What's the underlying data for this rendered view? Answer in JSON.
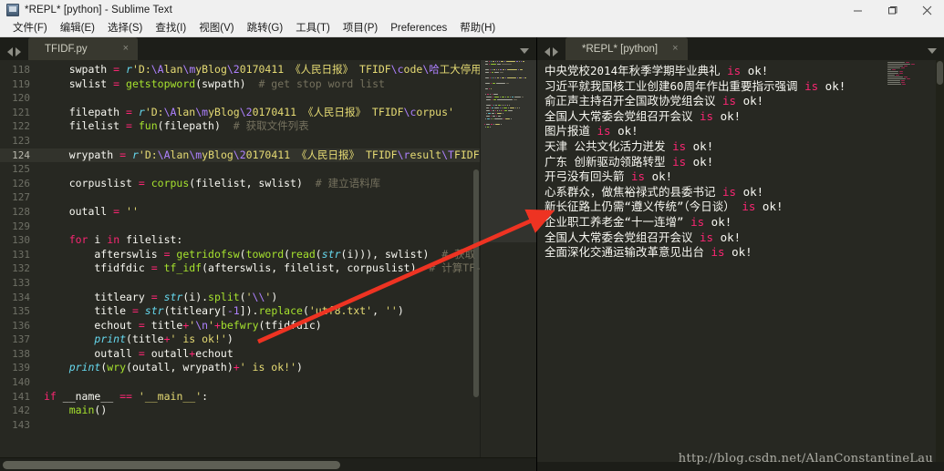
{
  "window": {
    "title": "*REPL* [python] - Sublime Text",
    "app_icon": "sublime-text-icon",
    "controls": {
      "minimize": "minimize-icon",
      "maximize": "maximize-icon",
      "close": "close-icon"
    }
  },
  "menubar": {
    "items": [
      "文件(F)",
      "编辑(E)",
      "选择(S)",
      "查找(I)",
      "视图(V)",
      "跳转(G)",
      "工具(T)",
      "项目(P)",
      "Preferences",
      "帮助(H)"
    ]
  },
  "left_pane": {
    "tab": {
      "label": "TFIDF.py",
      "close": "×"
    },
    "nav_prev": "nav-prev-icon",
    "nav_next": "nav-next-icon",
    "tab_menu": "tab-list-caret-icon",
    "current_line": 124,
    "lines": [
      {
        "n": 118,
        "tokens": [
          {
            "t": "    swpath ",
            "c": "p"
          },
          {
            "t": "= ",
            "c": "k"
          },
          {
            "t": "r",
            "c": "f"
          },
          {
            "t": "'D:",
            "c": "s"
          },
          {
            "t": "\\A",
            "c": "n"
          },
          {
            "t": "lan",
            "c": "s"
          },
          {
            "t": "\\m",
            "c": "n"
          },
          {
            "t": "yBlog",
            "c": "s"
          },
          {
            "t": "\\2",
            "c": "n"
          },
          {
            "t": "0170411 《人民日报》 TFIDF",
            "c": "s"
          },
          {
            "t": "\\c",
            "c": "n"
          },
          {
            "t": "ode",
            "c": "s"
          },
          {
            "t": "\\哈",
            "c": "n"
          },
          {
            "t": "工大停用",
            "c": "s"
          }
        ]
      },
      {
        "n": 119,
        "tokens": [
          {
            "t": "    swlist ",
            "c": "p"
          },
          {
            "t": "= ",
            "c": "k"
          },
          {
            "t": "getstopword",
            "c": "fn"
          },
          {
            "t": "(swpath)  ",
            "c": "p"
          },
          {
            "t": "# get stop word list",
            "c": "c"
          }
        ]
      },
      {
        "n": 120,
        "tokens": []
      },
      {
        "n": 121,
        "tokens": [
          {
            "t": "    filepath ",
            "c": "p"
          },
          {
            "t": "= ",
            "c": "k"
          },
          {
            "t": "r",
            "c": "f"
          },
          {
            "t": "'D:",
            "c": "s"
          },
          {
            "t": "\\A",
            "c": "n"
          },
          {
            "t": "lan",
            "c": "s"
          },
          {
            "t": "\\m",
            "c": "n"
          },
          {
            "t": "yBlog",
            "c": "s"
          },
          {
            "t": "\\2",
            "c": "n"
          },
          {
            "t": "0170411 《人民日报》 TFIDF",
            "c": "s"
          },
          {
            "t": "\\c",
            "c": "n"
          },
          {
            "t": "orpus'",
            "c": "s"
          }
        ]
      },
      {
        "n": 122,
        "tokens": [
          {
            "t": "    filelist ",
            "c": "p"
          },
          {
            "t": "= ",
            "c": "k"
          },
          {
            "t": "fun",
            "c": "fn"
          },
          {
            "t": "(filepath)  ",
            "c": "p"
          },
          {
            "t": "# 获取文件列表",
            "c": "c"
          }
        ]
      },
      {
        "n": 123,
        "tokens": []
      },
      {
        "n": 124,
        "tokens": [
          {
            "t": "    wrypath ",
            "c": "p"
          },
          {
            "t": "= ",
            "c": "k"
          },
          {
            "t": "r",
            "c": "f"
          },
          {
            "t": "'D:",
            "c": "s"
          },
          {
            "t": "\\A",
            "c": "n"
          },
          {
            "t": "lan",
            "c": "s"
          },
          {
            "t": "\\m",
            "c": "n"
          },
          {
            "t": "yBlog",
            "c": "s"
          },
          {
            "t": "\\2",
            "c": "n"
          },
          {
            "t": "0170411 《人民日报》 TFIDF",
            "c": "s"
          },
          {
            "t": "\\r",
            "c": "n"
          },
          {
            "t": "esult",
            "c": "s"
          },
          {
            "t": "\\T",
            "c": "n"
          },
          {
            "t": "FIDF.",
            "c": "s"
          }
        ]
      },
      {
        "n": 125,
        "tokens": []
      },
      {
        "n": 126,
        "tokens": [
          {
            "t": "    corpuslist ",
            "c": "p"
          },
          {
            "t": "= ",
            "c": "k"
          },
          {
            "t": "corpus",
            "c": "fn"
          },
          {
            "t": "(filelist, swlist)  ",
            "c": "p"
          },
          {
            "t": "# 建立语料库",
            "c": "c"
          }
        ]
      },
      {
        "n": 127,
        "tokens": []
      },
      {
        "n": 128,
        "tokens": [
          {
            "t": "    outall ",
            "c": "p"
          },
          {
            "t": "= ",
            "c": "k"
          },
          {
            "t": "''",
            "c": "s"
          }
        ]
      },
      {
        "n": 129,
        "tokens": []
      },
      {
        "n": 130,
        "tokens": [
          {
            "t": "    ",
            "c": "p"
          },
          {
            "t": "for",
            "c": "k"
          },
          {
            "t": " i ",
            "c": "p"
          },
          {
            "t": "in",
            "c": "k"
          },
          {
            "t": " filelist:",
            "c": "p"
          }
        ]
      },
      {
        "n": 131,
        "tokens": [
          {
            "t": "        afterswlis ",
            "c": "p"
          },
          {
            "t": "= ",
            "c": "k"
          },
          {
            "t": "getridofsw",
            "c": "fn"
          },
          {
            "t": "(",
            "c": "p"
          },
          {
            "t": "toword",
            "c": "fn"
          },
          {
            "t": "(",
            "c": "p"
          },
          {
            "t": "read",
            "c": "fn"
          },
          {
            "t": "(",
            "c": "p"
          },
          {
            "t": "str",
            "c": "f"
          },
          {
            "t": "(i))), swlist)  ",
            "c": "p"
          },
          {
            "t": "# 获取",
            "c": "c"
          }
        ]
      },
      {
        "n": 132,
        "tokens": [
          {
            "t": "        tfidfdic ",
            "c": "p"
          },
          {
            "t": "= ",
            "c": "k"
          },
          {
            "t": "tf_idf",
            "c": "fn"
          },
          {
            "t": "(afterswlis, filelist, corpuslist)  ",
            "c": "p"
          },
          {
            "t": "# 计算TF-",
            "c": "c"
          }
        ]
      },
      {
        "n": 133,
        "tokens": []
      },
      {
        "n": 134,
        "tokens": [
          {
            "t": "        titleary ",
            "c": "p"
          },
          {
            "t": "= ",
            "c": "k"
          },
          {
            "t": "str",
            "c": "f"
          },
          {
            "t": "(i).",
            "c": "p"
          },
          {
            "t": "split",
            "c": "fn"
          },
          {
            "t": "(",
            "c": "p"
          },
          {
            "t": "'",
            "c": "s"
          },
          {
            "t": "\\\\",
            "c": "n"
          },
          {
            "t": "'",
            "c": "s"
          },
          {
            "t": ")",
            "c": "p"
          }
        ]
      },
      {
        "n": 135,
        "tokens": [
          {
            "t": "        title ",
            "c": "p"
          },
          {
            "t": "= ",
            "c": "k"
          },
          {
            "t": "str",
            "c": "f"
          },
          {
            "t": "(titleary[",
            "c": "p"
          },
          {
            "t": "-1",
            "c": "n"
          },
          {
            "t": "]).",
            "c": "p"
          },
          {
            "t": "replace",
            "c": "fn"
          },
          {
            "t": "(",
            "c": "p"
          },
          {
            "t": "'utf8.txt'",
            "c": "s"
          },
          {
            "t": ", ",
            "c": "p"
          },
          {
            "t": "''",
            "c": "s"
          },
          {
            "t": ")",
            "c": "p"
          }
        ]
      },
      {
        "n": 136,
        "tokens": [
          {
            "t": "        echout ",
            "c": "p"
          },
          {
            "t": "= ",
            "c": "k"
          },
          {
            "t": "title",
            "c": "p"
          },
          {
            "t": "+",
            "c": "k"
          },
          {
            "t": "'",
            "c": "s"
          },
          {
            "t": "\\n",
            "c": "n"
          },
          {
            "t": "'",
            "c": "s"
          },
          {
            "t": "+",
            "c": "k"
          },
          {
            "t": "befwry",
            "c": "fn"
          },
          {
            "t": "(tfidfdic)",
            "c": "p"
          }
        ]
      },
      {
        "n": 137,
        "tokens": [
          {
            "t": "        ",
            "c": "p"
          },
          {
            "t": "print",
            "c": "f"
          },
          {
            "t": "(title",
            "c": "p"
          },
          {
            "t": "+",
            "c": "k"
          },
          {
            "t": "' is ok!'",
            "c": "s"
          },
          {
            "t": ")",
            "c": "p"
          }
        ]
      },
      {
        "n": 138,
        "tokens": [
          {
            "t": "        outall ",
            "c": "p"
          },
          {
            "t": "= ",
            "c": "k"
          },
          {
            "t": "outall",
            "c": "p"
          },
          {
            "t": "+",
            "c": "k"
          },
          {
            "t": "echout",
            "c": "p"
          }
        ]
      },
      {
        "n": 139,
        "tokens": [
          {
            "t": "    ",
            "c": "p"
          },
          {
            "t": "print",
            "c": "f"
          },
          {
            "t": "(",
            "c": "p"
          },
          {
            "t": "wry",
            "c": "fn"
          },
          {
            "t": "(outall, wrypath)",
            "c": "p"
          },
          {
            "t": "+",
            "c": "k"
          },
          {
            "t": "' is ok!'",
            "c": "s"
          },
          {
            "t": ")",
            "c": "p"
          }
        ]
      },
      {
        "n": 140,
        "tokens": []
      },
      {
        "n": 141,
        "tokens": [
          {
            "t": "if",
            "c": "k"
          },
          {
            "t": " __name__ ",
            "c": "p"
          },
          {
            "t": "==",
            "c": "k"
          },
          {
            "t": " ",
            "c": "p"
          },
          {
            "t": "'__main__'",
            "c": "s"
          },
          {
            "t": ":",
            "c": "p"
          }
        ]
      },
      {
        "n": 142,
        "tokens": [
          {
            "t": "    ",
            "c": "p"
          },
          {
            "t": "main",
            "c": "fn"
          },
          {
            "t": "()",
            "c": "p"
          }
        ]
      },
      {
        "n": 143,
        "tokens": []
      }
    ]
  },
  "right_pane": {
    "tab": {
      "label": "*REPL* [python]",
      "close": "×"
    },
    "nav_prev": "nav-prev-icon",
    "nav_next": "nav-next-icon",
    "tab_menu": "tab-list-caret-icon",
    "output": [
      {
        "text": "中央党校2014年秋季学期毕业典礼",
        "status": "is",
        "tail": "ok!"
      },
      {
        "text": "习近平就我国核工业创建60周年作出重要指示强调",
        "status": "is",
        "tail": "ok!"
      },
      {
        "text": "俞正声主持召开全国政协党组会议",
        "status": "is",
        "tail": "ok!"
      },
      {
        "text": "全国人大常委会党组召开会议",
        "status": "is",
        "tail": "ok!"
      },
      {
        "text": "图片报道",
        "status": "is",
        "tail": "ok!"
      },
      {
        "text": "天津 公共文化活力迸发",
        "status": "is",
        "tail": "ok!"
      },
      {
        "text": "广东 创新驱动领路转型",
        "status": "is",
        "tail": "ok!"
      },
      {
        "text": "开弓没有回头箭",
        "status": "is",
        "tail": "ok!"
      },
      {
        "text": "心系群众，做焦裕禄式的县委书记",
        "status": "is",
        "tail": "ok!"
      },
      {
        "text": "新长征路上仍需“遵义传统”（今日谈）",
        "status": "is",
        "tail": "ok!"
      },
      {
        "text": "企业职工养老金“十一连增”",
        "status": "is",
        "tail": "ok!"
      },
      {
        "text": "全国人大常委会党组召开会议",
        "status": "is",
        "tail": "ok!"
      },
      {
        "text": "全面深化交通运输改革意见出台",
        "status": "is",
        "tail": "ok!"
      }
    ]
  },
  "annotation": {
    "arrow": "red-arrow-annotation",
    "color": "#ee3322"
  },
  "watermark": "http://blog.csdn.net/AlanConstantineLau",
  "colors": {
    "editor_bg": "#272822",
    "keyword": "#f92672",
    "string": "#e6db74",
    "function": "#a6e22e",
    "builtin": "#66d9ef",
    "comment": "#75715e",
    "number": "#ae81ff",
    "text": "#f8f8f2",
    "chrome": "#f0f0f0"
  }
}
